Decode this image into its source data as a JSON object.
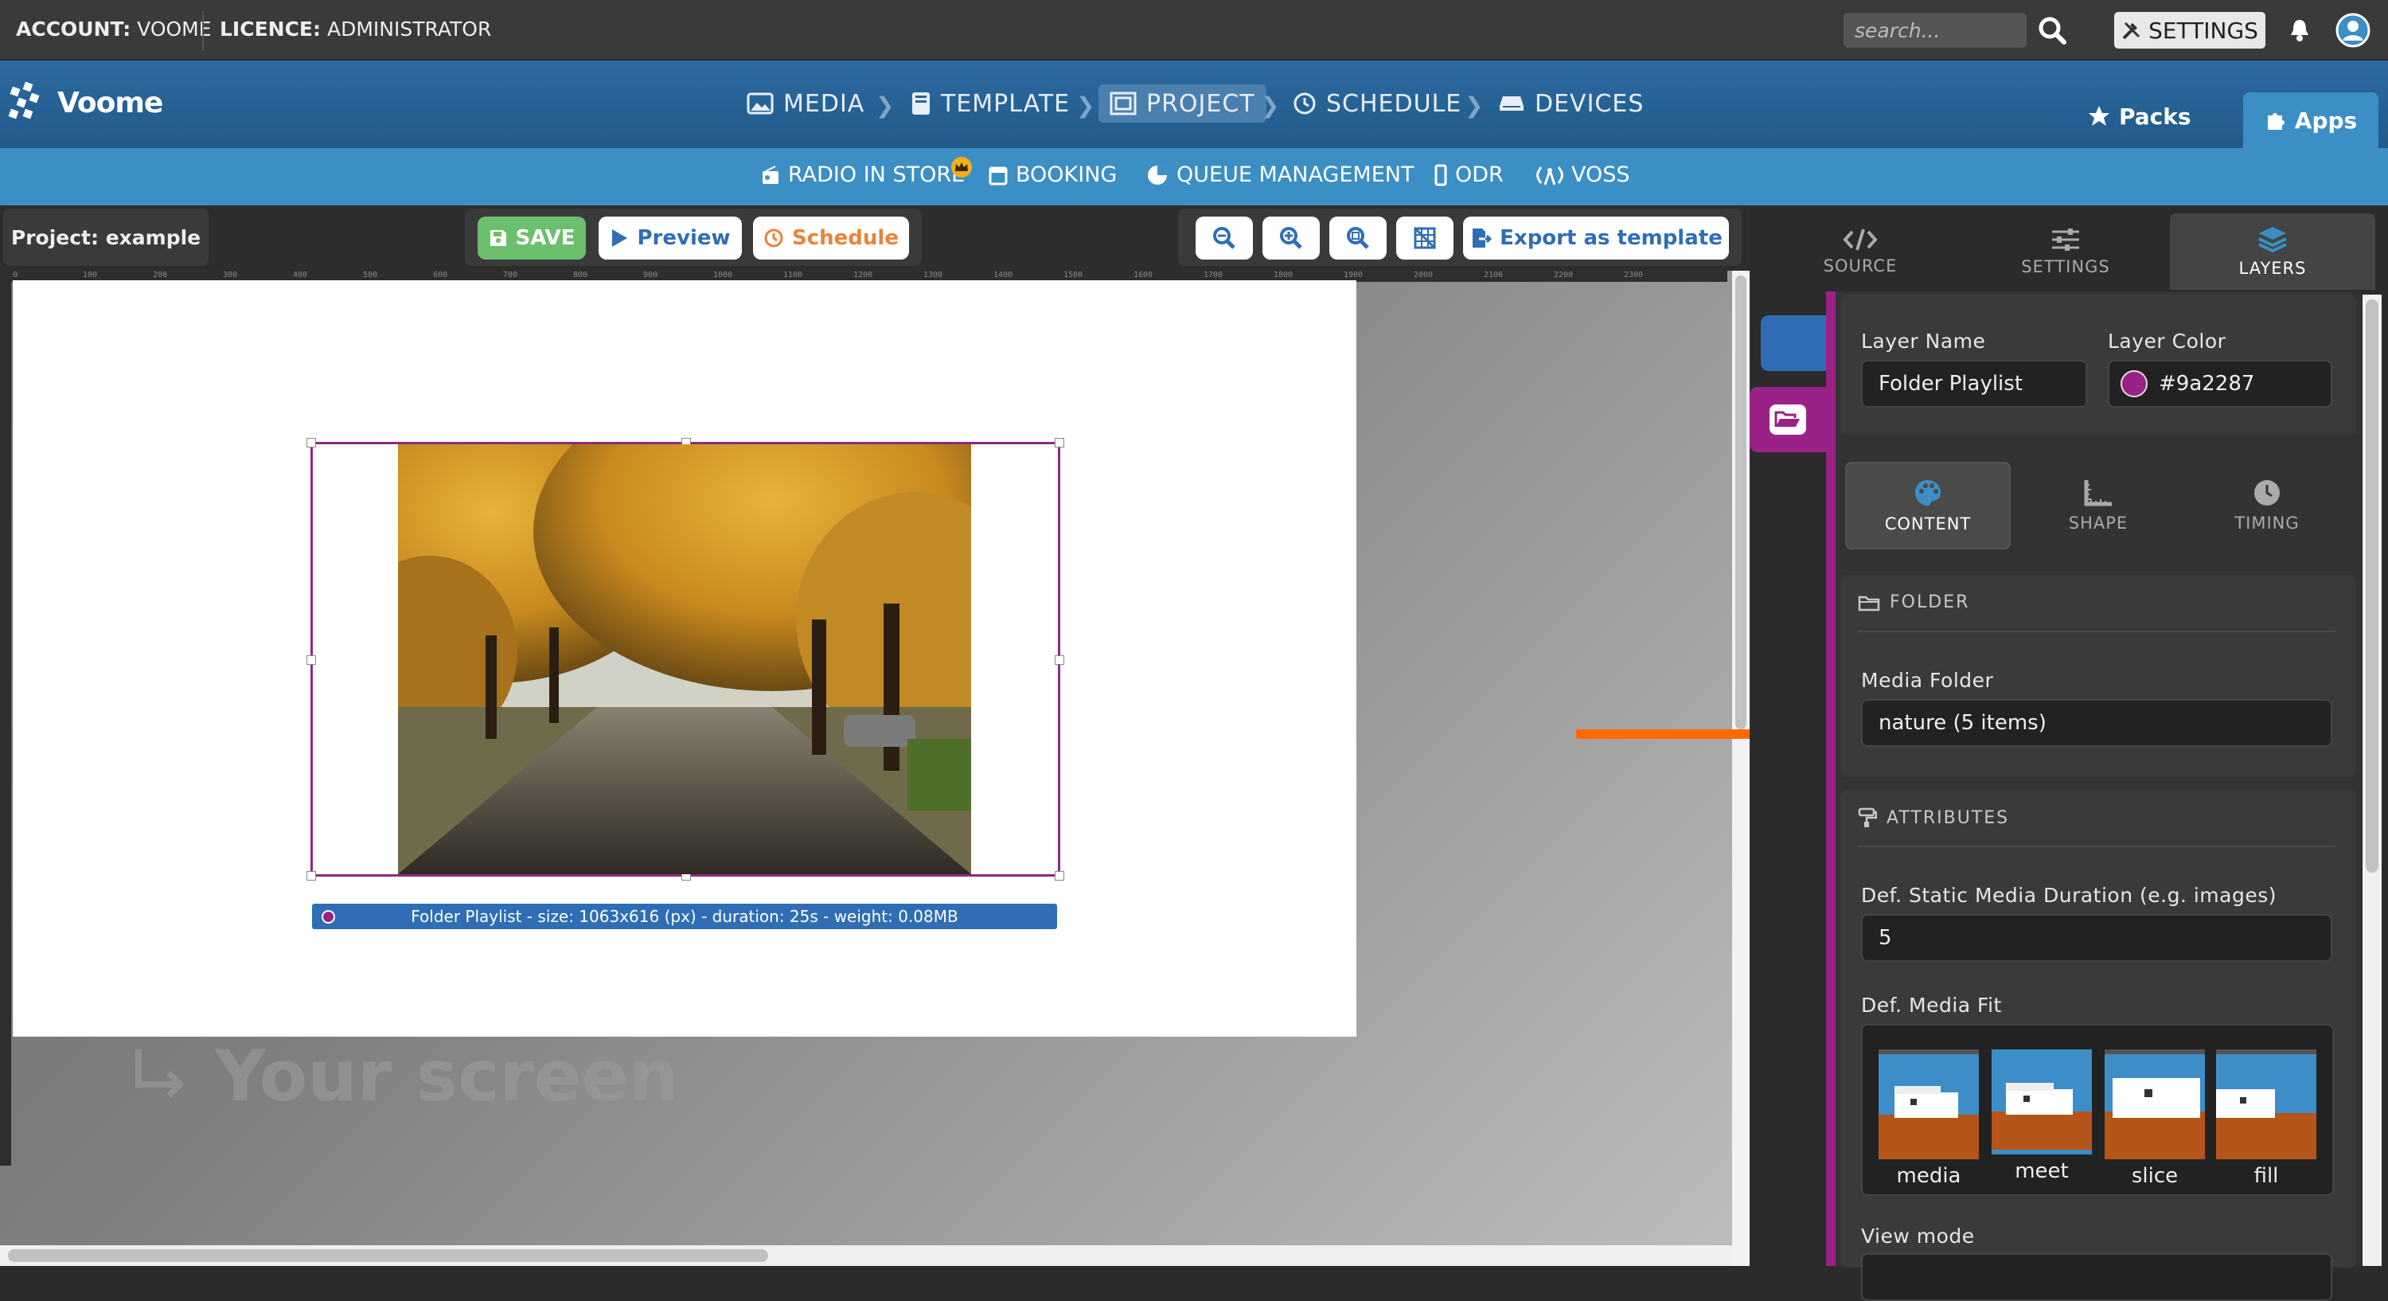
{
  "topbar": {
    "account_label": "ACCOUNT:",
    "account_value": "VOOME",
    "licence_label": "LICENCE:",
    "licence_value": "ADMINISTRATOR",
    "search_placeholder": "search...",
    "settings_label": "SETTINGS"
  },
  "brand": {
    "name": "Voome"
  },
  "workflow": [
    {
      "label": "MEDIA",
      "icon": "image-icon"
    },
    {
      "label": "TEMPLATE",
      "icon": "book-icon"
    },
    {
      "label": "PROJECT",
      "icon": "project-icon",
      "active": true
    },
    {
      "label": "SCHEDULE",
      "icon": "clock-icon"
    },
    {
      "label": "DEVICES",
      "icon": "device-icon"
    }
  ],
  "right_nav": {
    "packs": "Packs",
    "apps": "Apps"
  },
  "apps_nav": [
    {
      "label": "RADIO IN STORE",
      "icon": "radio-icon",
      "badge": "crown"
    },
    {
      "label": "BOOKING",
      "icon": "calendar-icon"
    },
    {
      "label": "QUEUE MANAGEMENT",
      "icon": "pie-chart-icon"
    },
    {
      "label": "ODR",
      "icon": "mobile-icon"
    },
    {
      "label": "VOSS",
      "icon": "antenna-icon"
    }
  ],
  "toolbar": {
    "project_name": "Project: example",
    "save": "SAVE",
    "preview": "Preview",
    "schedule": "Schedule",
    "export": "Export as template"
  },
  "ruler": [
    "0",
    "100",
    "200",
    "300",
    "400",
    "500",
    "600",
    "700",
    "800",
    "900",
    "1000",
    "1100",
    "1200",
    "1300",
    "1400",
    "1500",
    "1600",
    "1700",
    "1800",
    "1900",
    "2000",
    "2100",
    "2200",
    "2300"
  ],
  "canvas": {
    "your_screen": "Your screen",
    "layer_caption": "Folder Playlist - size: 1063x616 (px) - duration: 25s - weight: 0.08MB"
  },
  "side_tabs": [
    {
      "label": "SOURCE",
      "icon": "code-icon"
    },
    {
      "label": "SETTINGS",
      "icon": "sliders-icon"
    },
    {
      "label": "LAYERS",
      "icon": "layers-icon",
      "active": true
    }
  ],
  "layer": {
    "name_label": "Layer Name",
    "name_value": "Folder Playlist",
    "color_label": "Layer Color",
    "color_value": "#9a2287"
  },
  "layer_tabs": [
    {
      "label": "CONTENT",
      "icon": "palette-icon",
      "active": true
    },
    {
      "label": "SHAPE",
      "icon": "ruler-icon"
    },
    {
      "label": "TIMING",
      "icon": "clock-icon"
    }
  ],
  "folder_section": {
    "title": "FOLDER",
    "media_folder_label": "Media Folder",
    "media_folder_value": "nature (5 items)"
  },
  "attributes_section": {
    "title": "ATTRIBUTES",
    "duration_label": "Def. Static Media Duration (e.g. images)",
    "duration_value": "5",
    "fit_label": "Def. Media Fit",
    "fit_options": [
      "media",
      "meet",
      "slice",
      "fill"
    ],
    "fit_selected": "meet",
    "view_mode_label": "View mode"
  },
  "colors": {
    "accent_blue": "#3b8fc4",
    "layer_purple": "#9a2287",
    "save_green": "#6cbf6c",
    "schedule_orange": "#e8843a",
    "arrow_orange": "#ff6a00"
  }
}
